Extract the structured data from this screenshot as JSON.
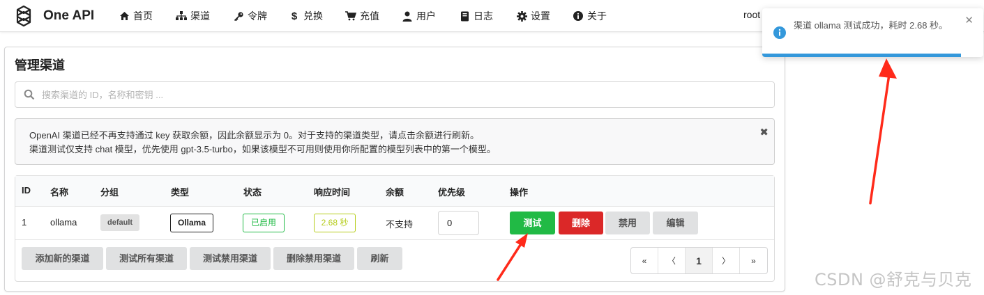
{
  "app": {
    "title": "One API",
    "user": "root"
  },
  "nav": {
    "items": [
      {
        "label": "首页",
        "icon": "home-icon"
      },
      {
        "label": "渠道",
        "icon": "sitemap-icon"
      },
      {
        "label": "令牌",
        "icon": "key-icon"
      },
      {
        "label": "兑换",
        "icon": "dollar-icon"
      },
      {
        "label": "充值",
        "icon": "cart-icon"
      },
      {
        "label": "用户",
        "icon": "user-icon"
      },
      {
        "label": "日志",
        "icon": "book-icon"
      },
      {
        "label": "设置",
        "icon": "gear-icon"
      },
      {
        "label": "关于",
        "icon": "info-icon"
      }
    ]
  },
  "page": {
    "title": "管理渠道",
    "search_placeholder": "搜索渠道的 ID，名称和密钥 ...",
    "notice_line1": "OpenAI 渠道已经不再支持通过 key 获取余额，因此余额显示为 0。对于支持的渠道类型，请点击余额进行刷新。",
    "notice_line2": "渠道测试仅支持 chat 模型，优先使用 gpt-3.5-turbo，如果该模型不可用则使用你所配置的模型列表中的第一个模型。",
    "notice_close": "✖"
  },
  "table": {
    "headers": [
      "ID",
      "名称",
      "分组",
      "类型",
      "状态",
      "响应时间",
      "余额",
      "优先级",
      "操作"
    ],
    "rows": [
      {
        "id": "1",
        "name": "ollama",
        "group": "default",
        "type": "Ollama",
        "status": "已启用",
        "response_time": "2.68 秒",
        "balance": "不支持",
        "priority": "0"
      }
    ],
    "actions": {
      "test": "测试",
      "delete": "删除",
      "disable": "禁用",
      "edit": "编辑"
    }
  },
  "footer": {
    "add": "添加新的渠道",
    "test_all": "测试所有渠道",
    "test_disabled": "测试禁用渠道",
    "delete_disabled": "删除禁用渠道",
    "refresh": "刷新"
  },
  "pagination": {
    "first": "«",
    "prev": "〈",
    "current": "1",
    "next": "〉",
    "last": "»"
  },
  "toast": {
    "message": "渠道 ollama 测试成功，耗时 2.68 秒。",
    "close": "✕",
    "progress": 0.9,
    "color": "#3498db"
  },
  "watermark": "CSDN @舒克与贝克",
  "colors": {
    "success": "#21ba45",
    "danger": "#db2828",
    "olive": "#b5cc18",
    "annotation": "#ff2a1a"
  }
}
